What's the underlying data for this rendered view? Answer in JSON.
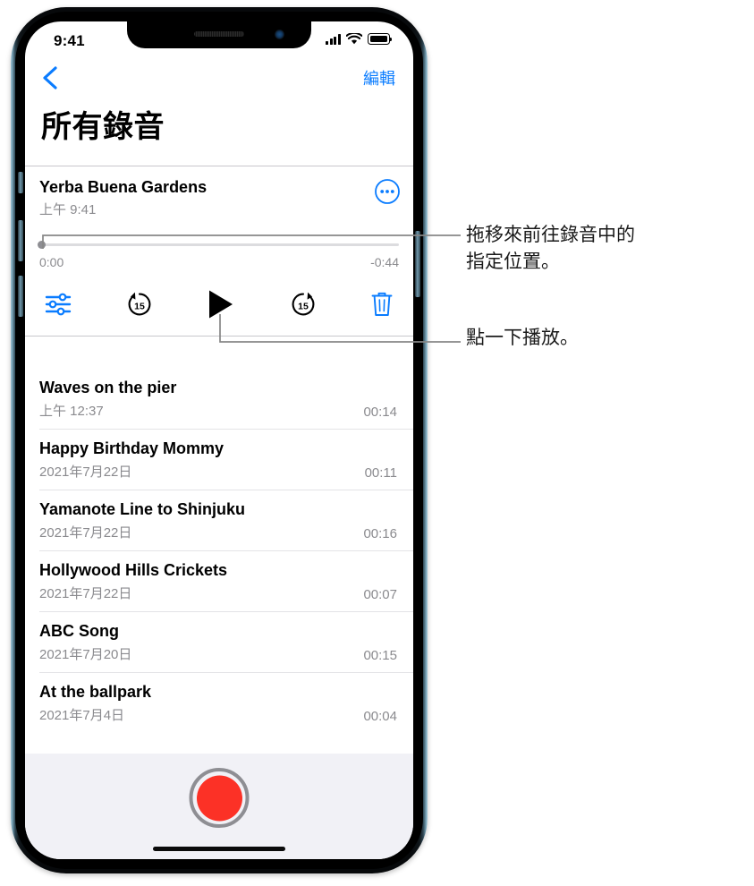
{
  "status_bar": {
    "time": "9:41",
    "signal_icon": "cellular-bars-icon",
    "wifi_icon": "wifi-icon",
    "battery_icon": "battery-full-icon"
  },
  "nav": {
    "back_icon": "chevron-left-icon",
    "edit_label": "編輯",
    "page_title": "所有錄音"
  },
  "selected_recording": {
    "title": "Yerba Buena Gardens",
    "meta": "上午 9:41",
    "more_icon": "ellipsis-circle-icon",
    "scrubber": {
      "position_percent": 0,
      "elapsed": "0:00",
      "remaining": "-0:44"
    },
    "controls": [
      {
        "name": "edit-recording-button",
        "icon": "sliders-icon",
        "color": "#0a7cff"
      },
      {
        "name": "skip-back-15-button",
        "icon": "go-back-15-icon",
        "label": "15",
        "color": "#000000"
      },
      {
        "name": "play-button",
        "icon": "play-icon",
        "color": "#000000"
      },
      {
        "name": "skip-forward-15-button",
        "icon": "go-forward-15-icon",
        "label": "15",
        "color": "#000000"
      },
      {
        "name": "delete-button",
        "icon": "trash-icon",
        "color": "#0a7cff"
      }
    ]
  },
  "recordings": [
    {
      "title": "Waves on the pier",
      "date": "上午 12:37",
      "duration": "00:14"
    },
    {
      "title": "Happy Birthday Mommy",
      "date": "2021年7月22日",
      "duration": "00:11"
    },
    {
      "title": "Yamanote Line to Shinjuku",
      "date": "2021年7月22日",
      "duration": "00:16"
    },
    {
      "title": "Hollywood Hills Crickets",
      "date": "2021年7月22日",
      "duration": "00:07"
    },
    {
      "title": "ABC Song",
      "date": "2021年7月20日",
      "duration": "00:15"
    },
    {
      "title": "At the ballpark",
      "date": "2021年7月4日",
      "duration": "00:04"
    }
  ],
  "record_bar": {
    "record_button_name": "record-button",
    "record_color": "#fc3126",
    "ring_color": "#8e8e93"
  },
  "callouts": [
    {
      "id": "scrubber-callout",
      "text": "拖移來前往錄音中的\n指定位置。"
    },
    {
      "id": "play-callout",
      "text": "點一下播放。"
    }
  ],
  "theme": {
    "accent_blue": "#0a7cff",
    "secondary_text": "#8a8a8e",
    "separator": "#e3e3e6",
    "bottom_bar_bg": "#f1f1f6",
    "callout_line": "#878787"
  }
}
